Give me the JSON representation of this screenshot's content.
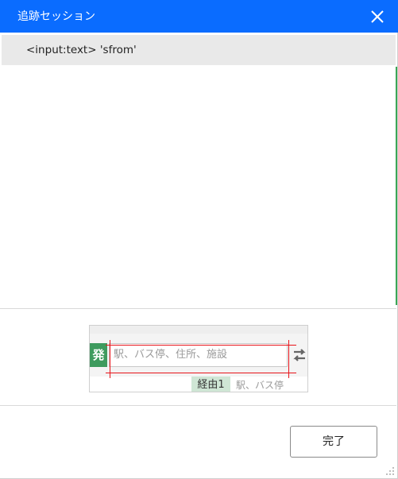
{
  "dialog": {
    "title": "追跡セッション",
    "close_icon": "close-icon",
    "accent_color": "#0a6cff"
  },
  "selector": {
    "text": "<input:text> 'sfrom'"
  },
  "preview": {
    "departure_label": "発",
    "departure_placeholder": "駅、バス停、住所、施設",
    "swap_icon": "swap-arrows-icon",
    "via_label": "経由1",
    "via_placeholder": "駅、バス停",
    "highlight_color": "#e8141a"
  },
  "footer": {
    "done_label": "完了"
  }
}
